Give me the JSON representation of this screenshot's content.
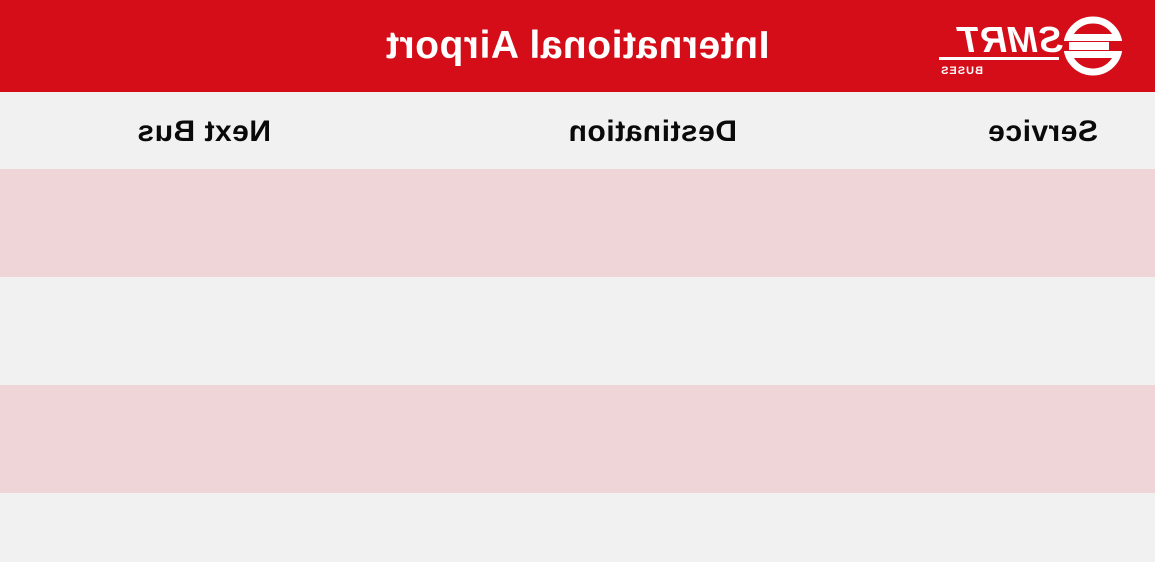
{
  "header": {
    "title": "International Airport",
    "brand_logo_text": "SMRT",
    "brand_logo_subtext": "BUSES",
    "background_color": "#d40d19",
    "title_color": "#ffffff"
  },
  "columns": {
    "service": "Service",
    "destination": "Destination",
    "next_bus": "Next Bus"
  },
  "rows": [
    {
      "service": "",
      "destination": "",
      "next_bus": "",
      "color": "#f0d5d8"
    },
    {
      "service": "",
      "destination": "",
      "next_bus": "",
      "color": "#f1f1f1"
    },
    {
      "service": "",
      "destination": "",
      "next_bus": "",
      "color": "#f0d5d8"
    },
    {
      "service": "",
      "destination": "",
      "next_bus": "",
      "color": "#f1f1f1"
    }
  ],
  "display": {
    "mirrored": true
  }
}
